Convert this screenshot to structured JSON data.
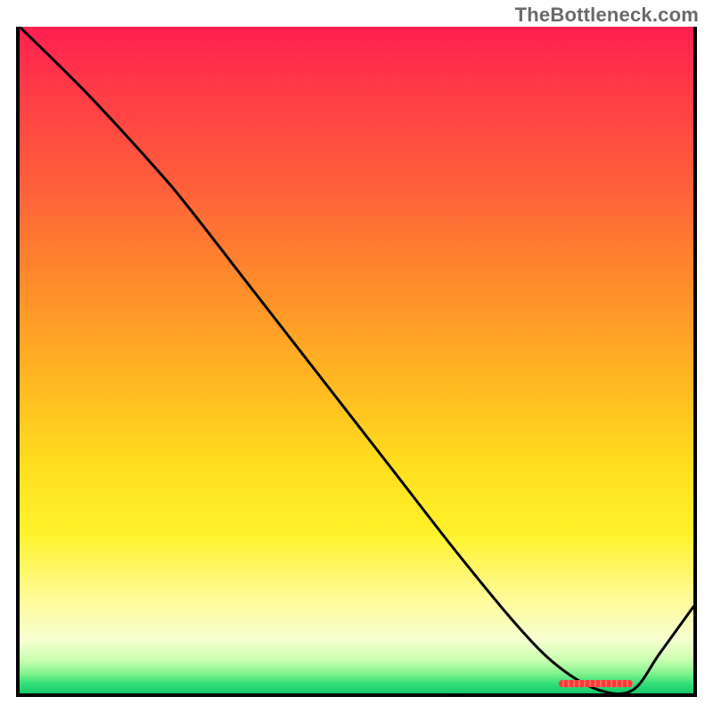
{
  "attribution": "TheBottleneck.com",
  "colors": {
    "curve": "#000000",
    "marker": "#ff3a3a",
    "axis": "#000000"
  },
  "chart_data": {
    "type": "line",
    "title": "",
    "xlabel": "",
    "ylabel": "",
    "xlim": [
      0,
      100
    ],
    "ylim": [
      0,
      100
    ],
    "grid": false,
    "legend": false,
    "x": [
      0,
      10,
      20,
      25,
      35,
      45,
      55,
      65,
      74,
      80,
      86,
      91,
      95,
      100
    ],
    "values": [
      100,
      90,
      79,
      73,
      60,
      47,
      34,
      21,
      10,
      4,
      0.5,
      0.5,
      6,
      13
    ],
    "optimum_range_x": [
      80,
      91
    ],
    "annotations": []
  }
}
